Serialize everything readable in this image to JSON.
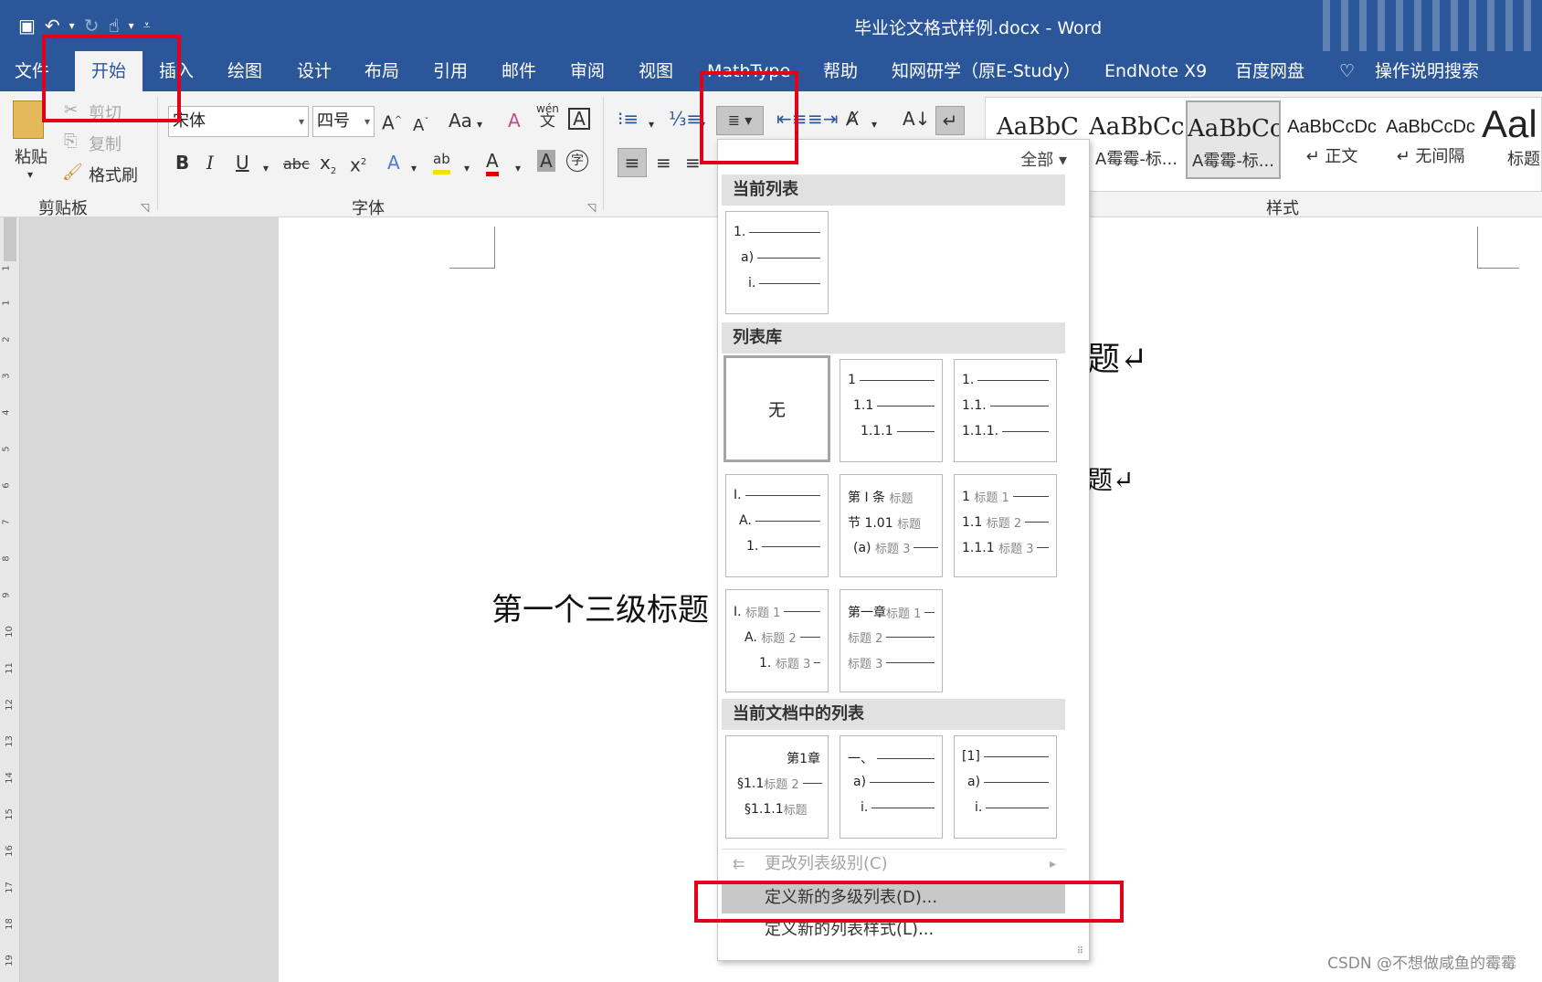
{
  "titlebar": {
    "doc_title": "毕业论文格式样例.docx  -  Word",
    "qat": [
      {
        "name": "save-icon",
        "glyph": "💾"
      },
      {
        "name": "undo-icon",
        "glyph": "↶"
      },
      {
        "name": "redo-icon",
        "glyph": "↻"
      },
      {
        "name": "touch-mode-icon",
        "glyph": "☝"
      },
      {
        "name": "customize-qat-icon",
        "glyph": "▾"
      }
    ]
  },
  "tabs": [
    {
      "label": "文件"
    },
    {
      "label": "开始"
    },
    {
      "label": "插入"
    },
    {
      "label": "绘图"
    },
    {
      "label": "设计"
    },
    {
      "label": "布局"
    },
    {
      "label": "引用"
    },
    {
      "label": "邮件"
    },
    {
      "label": "审阅"
    },
    {
      "label": "视图"
    },
    {
      "label": "MathType"
    },
    {
      "label": "帮助"
    },
    {
      "label": "知网研学（原E-Study）"
    },
    {
      "label": "EndNote X9"
    },
    {
      "label": "百度网盘"
    },
    {
      "label": "操作说明搜索"
    }
  ],
  "ribbon": {
    "clipboard": {
      "paste": "粘贴",
      "cut": "剪切",
      "copy": "复制",
      "format_painter": "格式刷",
      "group_label": "剪贴板"
    },
    "font": {
      "font_name": "宋体",
      "font_size": "四号",
      "group_label": "字体",
      "change_case": "Aa",
      "phonetic_guide": "wén",
      "phonetic_base": "文"
    },
    "styles": {
      "filter": "全部",
      "items": [
        {
          "sample": "AaBbC",
          "name": ""
        },
        {
          "sample": "AaBbCc",
          "name": "A霉霉-标..."
        },
        {
          "sample": "AaBbCc",
          "name": "A霉霉-标..."
        },
        {
          "sample": "AaBbCcDc",
          "name": "↵ 正文"
        },
        {
          "sample": "AaBbCcDc",
          "name": "↵ 无间隔"
        },
        {
          "sample": "Aal",
          "name": "标题"
        }
      ],
      "group_label": "样式"
    }
  },
  "document": {
    "heading_fragment_1": "题↵",
    "heading_fragment_2": "题↵",
    "third_level_heading": "第一个三级标题"
  },
  "dropdown": {
    "filter_label": "全部",
    "current_list_header": "当前列表",
    "library_header": "列表库",
    "doc_lists_header": "当前文档中的列表",
    "none_label": "无",
    "current_list_lines": [
      "1.",
      "a)",
      "i."
    ],
    "library_tiles": [
      {
        "lines": [
          [
            "1",
            ""
          ],
          [
            "1.1",
            ""
          ],
          [
            "1.1.1",
            ""
          ]
        ]
      },
      {
        "lines": [
          [
            "1.",
            ""
          ],
          [
            "1.1.",
            ""
          ],
          [
            "1.1.1.",
            ""
          ]
        ]
      },
      {
        "lines": [
          [
            "I.",
            ""
          ],
          [
            "A.",
            ""
          ],
          [
            "1.",
            ""
          ]
        ]
      },
      {
        "lines": [
          [
            "第 Ⅰ 条",
            "标题"
          ],
          [
            "节 1.01",
            "标题"
          ],
          [
            "(a)",
            "标题 3"
          ]
        ]
      },
      {
        "lines": [
          [
            "1",
            "标题 1"
          ],
          [
            "1.1",
            "标题 2"
          ],
          [
            "1.1.1",
            "标题 3"
          ]
        ]
      },
      {
        "lines": [
          [
            "I.",
            "标题 1"
          ],
          [
            "A.",
            "标题 2"
          ],
          [
            "1.",
            "标题 3"
          ]
        ]
      },
      {
        "lines": [
          [
            "第一章",
            "标题 1"
          ],
          [
            "",
            "标题 2"
          ],
          [
            "",
            "标题 3"
          ]
        ]
      }
    ],
    "doc_tiles": [
      {
        "lines": [
          [
            "第1章",
            ""
          ],
          [
            "§1.1",
            "标题 2"
          ],
          [
            "§1.1.1",
            "标题"
          ]
        ]
      },
      {
        "lines": [
          [
            "一、",
            ""
          ],
          [
            "a)",
            ""
          ],
          [
            "i.",
            ""
          ]
        ]
      },
      {
        "lines": [
          [
            "[1]",
            ""
          ],
          [
            "a)",
            ""
          ],
          [
            "i.",
            ""
          ]
        ]
      }
    ],
    "cmd_change_level": "更改列表级别(C)",
    "cmd_define_multilevel": "定义新的多级列表(D)...",
    "cmd_define_style": "定义新的列表样式(L)..."
  },
  "ruler_numbers": [
    "1",
    "1",
    "2",
    "3",
    "4",
    "5",
    "6",
    "7",
    "8",
    "9",
    "10",
    "11",
    "12",
    "13",
    "14",
    "15",
    "16",
    "17",
    "18",
    "19"
  ],
  "watermark": "CSDN @不想做咸鱼的霉霉",
  "colors": {
    "word_blue": "#2b579a",
    "annotation_red": "#e2001a"
  }
}
